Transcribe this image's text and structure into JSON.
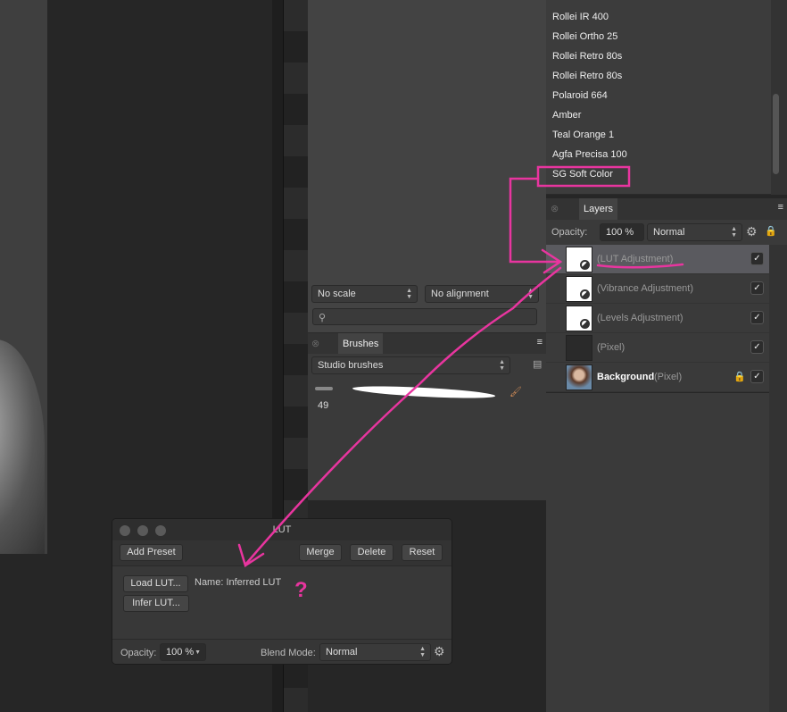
{
  "presets_list": [
    "Rollei IR 400",
    "Rollei Ortho 25",
    "Rollei Retro 80s",
    "Rollei Retro 80s",
    "Polaroid 664",
    "Amber",
    "Teal Orange 1",
    "Agfa Precisa 100",
    "SG Soft Color"
  ],
  "assets": {
    "scale": "No scale",
    "alignment": "No alignment",
    "search_placeholder": ""
  },
  "brushes": {
    "tab": "Brushes",
    "category": "Studio brushes",
    "brush_size": "49"
  },
  "layers": {
    "tab": "Layers",
    "opacity_label": "Opacity:",
    "opacity": "100 %",
    "blend": "Normal",
    "rows": [
      {
        "name": "(LUT Adjustment)",
        "selected": true
      },
      {
        "name": "(Vibrance Adjustment)"
      },
      {
        "name": "(Levels Adjustment)"
      },
      {
        "name": "(Pixel)"
      },
      {
        "name": "Background",
        "suffix": "(Pixel)",
        "locked": true
      }
    ]
  },
  "lut_dialog": {
    "title": "LUT",
    "add_preset": "Add Preset",
    "merge": "Merge",
    "delete": "Delete",
    "reset": "Reset",
    "load": "Load LUT...",
    "infer": "Infer LUT...",
    "name_label": "Name: Inferred LUT",
    "opacity_label": "Opacity:",
    "opacity": "100 %",
    "blend_label": "Blend Mode:",
    "blend": "Normal"
  },
  "annotation_text": "?",
  "colors": {
    "annotation": "#e8359f"
  }
}
